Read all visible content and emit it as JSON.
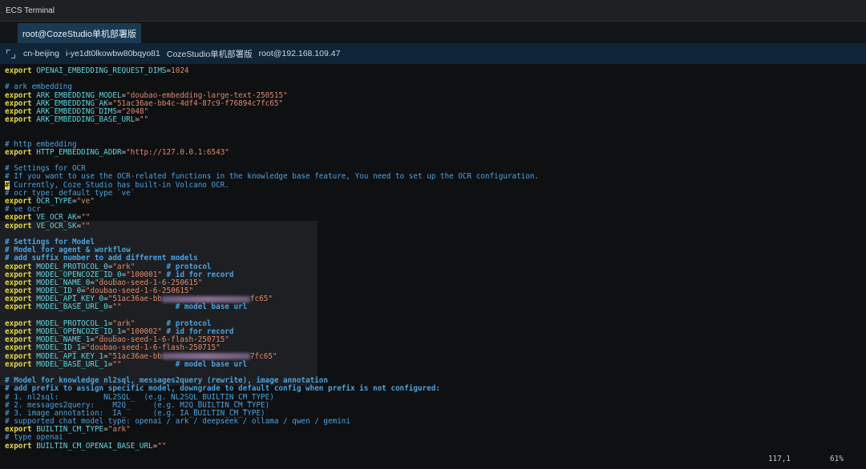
{
  "window": {
    "title": "ECS Terminal"
  },
  "tab": {
    "label": "root@CozeStudio单机部署版"
  },
  "info": {
    "region": "cn-beijing",
    "instance_id": "i-ye1dt0lkowbw80bqyo81",
    "instance_name": "CozeStudio单机部署版",
    "login": "root@192.168.109.47"
  },
  "editor": {
    "lines": [
      {
        "t": "exp",
        "k": "export",
        "v": " OPENAI_EMBEDDING_REQUEST_DIMS",
        "e": "=",
        "s": "1024"
      },
      {
        "t": "blank"
      },
      {
        "t": "cmt",
        "c": "# ark embedding"
      },
      {
        "t": "exp",
        "k": "export",
        "v": " ARK_EMBEDDING_MODEL",
        "e": "=",
        "s": "\"doubao-embedding-large-text-250515\""
      },
      {
        "t": "exp",
        "k": "export",
        "v": " ARK_EMBEDDING_AK",
        "e": "=",
        "s": "\"51ac36ae-bb4c-4df4-87c9-f76894c7fc65\""
      },
      {
        "t": "exp",
        "k": "export",
        "v": " ARK_EMBEDDING_DIMS",
        "e": "=",
        "s": "\"2048\""
      },
      {
        "t": "exp",
        "k": "export",
        "v": " ARK_EMBEDDING_BASE_URL",
        "e": "=",
        "s": "\"\""
      },
      {
        "t": "blank"
      },
      {
        "t": "blank"
      },
      {
        "t": "cmt",
        "c": "# http embedding"
      },
      {
        "t": "exp",
        "k": "export",
        "v": " HTTP_EMBEDDING_ADDR",
        "e": "=",
        "s": "\"http://127.0.0.1:6543\""
      },
      {
        "t": "blank"
      },
      {
        "t": "cmt",
        "c": "# Settings for OCR"
      },
      {
        "t": "cmt",
        "c": "# If you want to use the OCR-related functions in the knowledge base feature, You need to set up the OCR configuration."
      },
      {
        "t": "cur",
        "cur": "#",
        "c": " Currently, Coze Studio has built-in Volcano OCR."
      },
      {
        "t": "cmt",
        "c": "# ocr_type: default type `ve`"
      },
      {
        "t": "exp",
        "k": "export",
        "v": " OCR_TYPE",
        "e": "=",
        "s": "\"ve\""
      },
      {
        "t": "cmt",
        "c": "# ve ocr"
      },
      {
        "t": "exp",
        "k": "export",
        "v": " VE_OCR_AK",
        "e": "=",
        "s": "\"\""
      },
      {
        "t": "exp",
        "k": "export",
        "v": " VE_OCR_SK",
        "e": "=",
        "s": "\"\""
      },
      {
        "t": "blank"
      },
      {
        "t": "cmtb",
        "c": "# Settings for Model"
      },
      {
        "t": "cmtb",
        "c": "# Model for agent & workflow"
      },
      {
        "t": "cmtb",
        "c": "# add suffix number to add different models"
      },
      {
        "t": "expc",
        "k": "export",
        "v": " MODEL_PROTOCOL_0",
        "e": "=",
        "s": "\"ark\"",
        "c": "       # protocol"
      },
      {
        "t": "expc",
        "k": "export",
        "v": " MODEL_OPENCOZE_ID_0",
        "e": "=",
        "s": "\"100001\"",
        "c": " # id for record"
      },
      {
        "t": "exp",
        "k": "export",
        "v": " MODEL_NAME_0",
        "e": "=",
        "s": "\"doubao-seed-1-6-250615\""
      },
      {
        "t": "exp",
        "k": "export",
        "v": " MODEL_ID_0",
        "e": "=",
        "s": "\"doubao-seed-1-6-250615\""
      },
      {
        "t": "expblur",
        "k": "export",
        "v": " MODEL_API_KEY_0",
        "e": "=",
        "s1": "\"51ac36ae-bb",
        "bw": "110",
        "s2": "fc65\""
      },
      {
        "t": "expc",
        "k": "export",
        "v": " MODEL_BASE_URL_0",
        "e": "=",
        "s": "\"\"",
        "c": "            # model base url"
      },
      {
        "t": "blank"
      },
      {
        "t": "expc",
        "k": "export",
        "v": " MODEL_PROTOCOL_1",
        "e": "=",
        "s": "\"ark\"",
        "c": "       # protocol"
      },
      {
        "t": "expc",
        "k": "export",
        "v": " MODEL_OPENCOZE_ID_1",
        "e": "=",
        "s": "\"100002\"",
        "c": " # id for record"
      },
      {
        "t": "exp",
        "k": "export",
        "v": " MODEL_NAME_1",
        "e": "=",
        "s": "\"doubao-seed-1-6-flash-250715\""
      },
      {
        "t": "exp",
        "k": "export",
        "v": " MODEL_ID_1",
        "e": "=",
        "s": "\"doubao-seed-1-6-flash-250715\""
      },
      {
        "t": "expblur",
        "k": "export",
        "v": " MODEL_API_KEY_1",
        "e": "=",
        "s1": "\"51ac36ae-bb",
        "bw": "110",
        "s2": "7fc65\""
      },
      {
        "t": "expc",
        "k": "export",
        "v": " MODEL_BASE_URL_1",
        "e": "=",
        "s": "\"\"",
        "c": "            # model base url"
      },
      {
        "t": "blank"
      },
      {
        "t": "cmtb",
        "c": "# Model for knowledge nl2sql, messages2query (rewrite), image annotation"
      },
      {
        "t": "cmtb",
        "c": "# add prefix to assign specific model, downgrade to default config when prefix is not configured:"
      },
      {
        "t": "cmt",
        "c": "# 1. nl2sql:          NL2SQL_  (e.g. NL2SQL_BUILTIN_CM_TYPE)"
      },
      {
        "t": "cmt",
        "c": "# 2. messages2query:    M2Q_     (e.g. M2Q_BUILTIN_CM_TYPE)"
      },
      {
        "t": "cmt",
        "c": "# 3. image annotation:  IA_      (e.g. IA_BUILTIN_CM_TYPE)"
      },
      {
        "t": "cmt",
        "c": "# supported chat model type: openai / ark / deepseek / ollama / qwen / gemini"
      },
      {
        "t": "exp",
        "k": "export",
        "v": " BUILTIN_CM_TYPE",
        "e": "=",
        "s": "\"ark\""
      },
      {
        "t": "cmt",
        "c": "# type openai"
      },
      {
        "t": "exp",
        "k": "export",
        "v": " BUILTIN_CM_OPENAI_BASE_URL",
        "e": "=",
        "s": "\"\""
      }
    ]
  },
  "status": {
    "position": "117,1",
    "percent": "61%"
  }
}
